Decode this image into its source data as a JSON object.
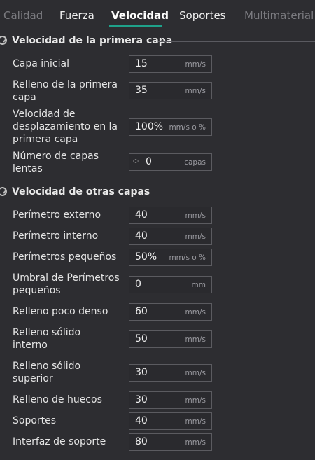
{
  "tabs": [
    {
      "label": "Calidad"
    },
    {
      "label": "Fuerza"
    },
    {
      "label": "Velocidad"
    },
    {
      "label": "Soportes"
    },
    {
      "label": "Multimaterial"
    }
  ],
  "accent_color": "#1fa18a",
  "first_layer": {
    "title": "Velocidad de la primera capa",
    "icon": "speedometer-icon",
    "rows": [
      {
        "label": "Capa inicial",
        "value": "15",
        "unit": "mm/s"
      },
      {
        "label": "Relleno de la primera capa",
        "value": "35",
        "unit": "mm/s"
      },
      {
        "label": "Velocidad de desplazamiento en la primera capa",
        "value": "100%",
        "unit": "mm/s o %"
      },
      {
        "label": "Número de capas lentas",
        "value": "0",
        "unit": "capas"
      }
    ]
  },
  "other_layers": {
    "title": "Velocidad de otras capas",
    "icon": "speedometer-icon",
    "rows": [
      {
        "label": "Perímetro externo",
        "value": "40",
        "unit": "mm/s"
      },
      {
        "label": "Perímetro interno",
        "value": "40",
        "unit": "mm/s"
      },
      {
        "label": "Perímetros pequeños",
        "value": "50%",
        "unit": "mm/s o %"
      },
      {
        "label": "Umbral de Perímetros pequeños",
        "value": "0",
        "unit": "mm"
      },
      {
        "label": "Relleno poco denso",
        "value": "60",
        "unit": "mm/s"
      },
      {
        "label": "Relleno sólido interno",
        "value": "50",
        "unit": "mm/s"
      },
      {
        "label": "Relleno sólido superior",
        "value": "30",
        "unit": "mm/s"
      },
      {
        "label": "Relleno de huecos",
        "value": "30",
        "unit": "mm/s"
      },
      {
        "label": "Soportes",
        "value": "40",
        "unit": "mm/s"
      },
      {
        "label": "Interfaz de soporte",
        "value": "80",
        "unit": "mm/s"
      }
    ]
  }
}
